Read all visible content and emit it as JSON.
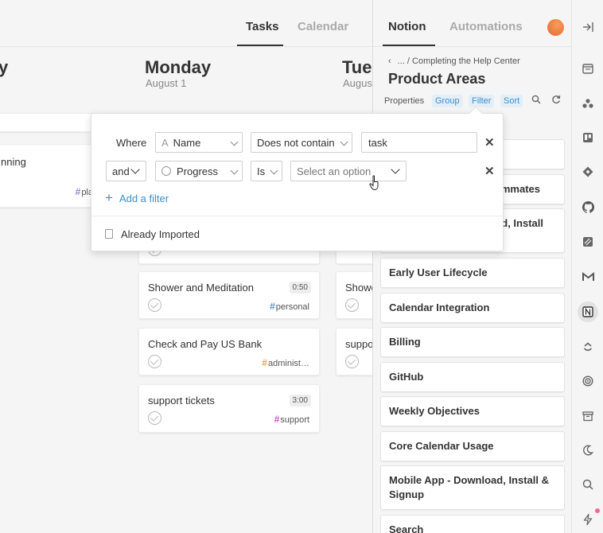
{
  "header": {
    "tabs": [
      {
        "label": "Tasks",
        "active": true
      },
      {
        "label": "Calendar",
        "active": false
      }
    ]
  },
  "days": [
    {
      "title": "y",
      "date": ""
    },
    {
      "title": "Monday",
      "date": "August 1"
    },
    {
      "title": "Tues",
      "date": "Augus"
    }
  ],
  "left_column": {
    "card_title": "nning",
    "card_tag": "pla"
  },
  "monday_tasks": [
    {
      "title": "Shower and Meditation",
      "duration": "0:50",
      "tag": "personal",
      "tag_color": "#5b8dd6"
    },
    {
      "title": "Check and Pay US Bank",
      "duration": "",
      "tag": "administ…",
      "tag_color": "#e8a33c"
    },
    {
      "title": "support tickets",
      "duration": "3:00",
      "tag": "support",
      "tag_color": "#c05ac0"
    }
  ],
  "tuesday_tasks": [
    {
      "title": "Showe"
    },
    {
      "title": "suppo"
    }
  ],
  "filter_popup": {
    "where_label": "Where",
    "row1": {
      "property": "Name",
      "operator": "Does not contain",
      "value": "task"
    },
    "row2": {
      "conjunction": "and",
      "property": "Progress",
      "operator": "Is",
      "value_placeholder": "Select an option"
    },
    "add_filter_label": "Add a filter",
    "imported_label": "Already Imported"
  },
  "right_panel": {
    "tabs": [
      {
        "label": "Notion",
        "active": true
      },
      {
        "label": "Automations",
        "active": false
      }
    ],
    "breadcrumb": "... / Completing the Help Center",
    "title": "Product Areas",
    "toolbar": {
      "properties": "Properties",
      "group": "Group",
      "filter": "Filter",
      "sort": "Sort"
    },
    "items_partial": [
      {
        "label": ""
      },
      {
        "label": "mmates"
      },
      {
        "label": "d, Install"
      }
    ],
    "items": [
      {
        "label": "Early User Lifecycle"
      },
      {
        "label": "Calendar Integration"
      },
      {
        "label": "Billing"
      },
      {
        "label": "GitHub"
      },
      {
        "label": "Weekly Objectives"
      },
      {
        "label": "Core Calendar Usage"
      },
      {
        "label": "Mobile App - Download, Install & Signup"
      },
      {
        "label": "Search"
      }
    ]
  },
  "sidebar": {
    "icons": [
      "collapse-icon",
      "calendar-app-icon",
      "asana-icon",
      "trello-icon",
      "jira-icon",
      "github-icon",
      "linear-icon",
      "gmail-icon",
      "notion-icon",
      "clickup-icon",
      "todoist-icon",
      "archive-icon",
      "dark-mode-icon",
      "search-icon",
      "bolt-icon"
    ]
  }
}
